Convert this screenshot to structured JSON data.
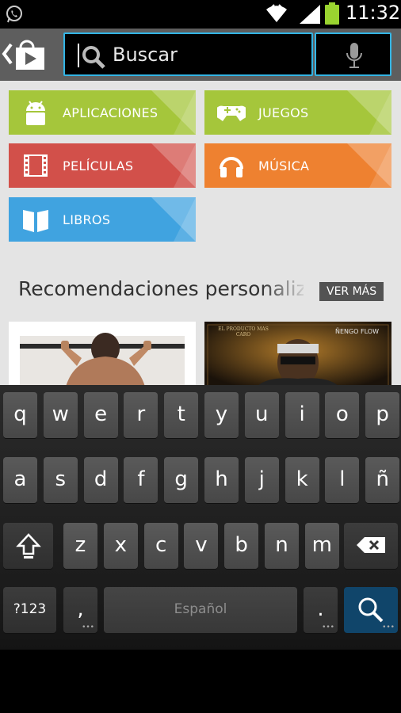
{
  "status_bar": {
    "time": "11:32"
  },
  "search": {
    "placeholder": "Buscar"
  },
  "categories": [
    {
      "label": "APLICACIONES",
      "icon": "android-icon",
      "color": "#a5c63b"
    },
    {
      "label": "JUEGOS",
      "icon": "gamepad-icon",
      "color": "#a5c63b"
    },
    {
      "label": "PELÍCULAS",
      "icon": "film-icon",
      "color": "#d2504a"
    },
    {
      "label": "MÚSICA",
      "icon": "headphones-icon",
      "color": "#ee8130"
    },
    {
      "label": "LIBROS",
      "icon": "book-icon",
      "color": "#40a3e0"
    }
  ],
  "recommendations": {
    "title": "Recomendaciones personalizadas",
    "see_more": "VER MÁS",
    "items": [
      {
        "image": "man-doing-pullups"
      },
      {
        "image": "album-cover",
        "caption_left": "EL PRODUCTO MAS CARO",
        "caption_right": "ÑENGO FLOW"
      }
    ]
  },
  "keyboard": {
    "row1": [
      "q",
      "w",
      "e",
      "r",
      "t",
      "y",
      "u",
      "i",
      "o",
      "p"
    ],
    "row2": [
      "a",
      "s",
      "d",
      "f",
      "g",
      "h",
      "j",
      "k",
      "l",
      "ñ"
    ],
    "row3": [
      "z",
      "x",
      "c",
      "v",
      "b",
      "n",
      "m"
    ],
    "symbols_label": "?123",
    "comma": ",",
    "period": ".",
    "space_label": "Español"
  },
  "colors": {
    "accent": "#33b5e5",
    "enter_key": "#10456a"
  }
}
